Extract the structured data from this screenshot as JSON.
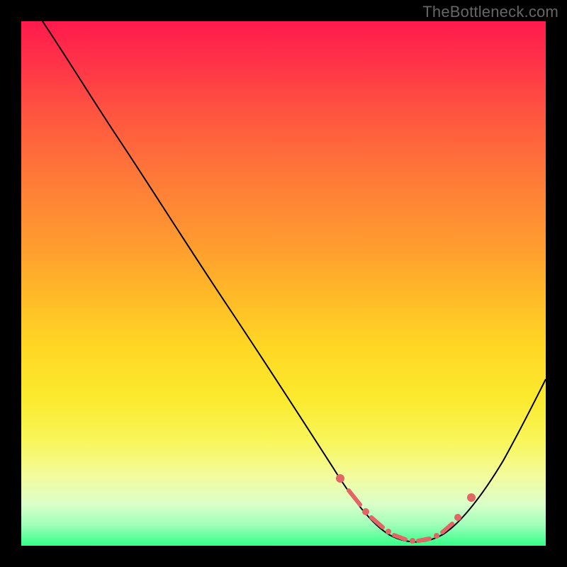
{
  "watermark": "TheBottleneck.com",
  "chart_data": {
    "type": "line",
    "title": "",
    "xlabel": "",
    "ylabel": "",
    "xlim": [
      0,
      100
    ],
    "ylim": [
      0,
      100
    ],
    "series": [
      {
        "name": "curve",
        "x": [
          4,
          10,
          15,
          20,
          25,
          30,
          35,
          40,
          45,
          50,
          55,
          58,
          62,
          66,
          70,
          74,
          78,
          82,
          86,
          90,
          94,
          98,
          100
        ],
        "y": [
          100,
          92,
          84,
          76,
          68,
          60,
          52,
          44,
          36,
          28,
          20,
          15,
          10,
          6,
          3.5,
          2,
          1.3,
          2.5,
          6,
          12,
          20,
          28,
          32
        ]
      }
    ],
    "markers": {
      "name": "highlight-region",
      "x": [
        61,
        64,
        67,
        69,
        71,
        73,
        76,
        79,
        81,
        83,
        85
      ],
      "y": [
        9,
        7,
        5.2,
        4,
        3.2,
        2.4,
        1.6,
        1.6,
        2.8,
        4.6,
        7
      ]
    },
    "colors": {
      "gradient_top": "#ff1a4d",
      "gradient_bottom": "#33ff88",
      "curve": "#000000",
      "markers": "#e36666",
      "frame": "#000000"
    }
  }
}
